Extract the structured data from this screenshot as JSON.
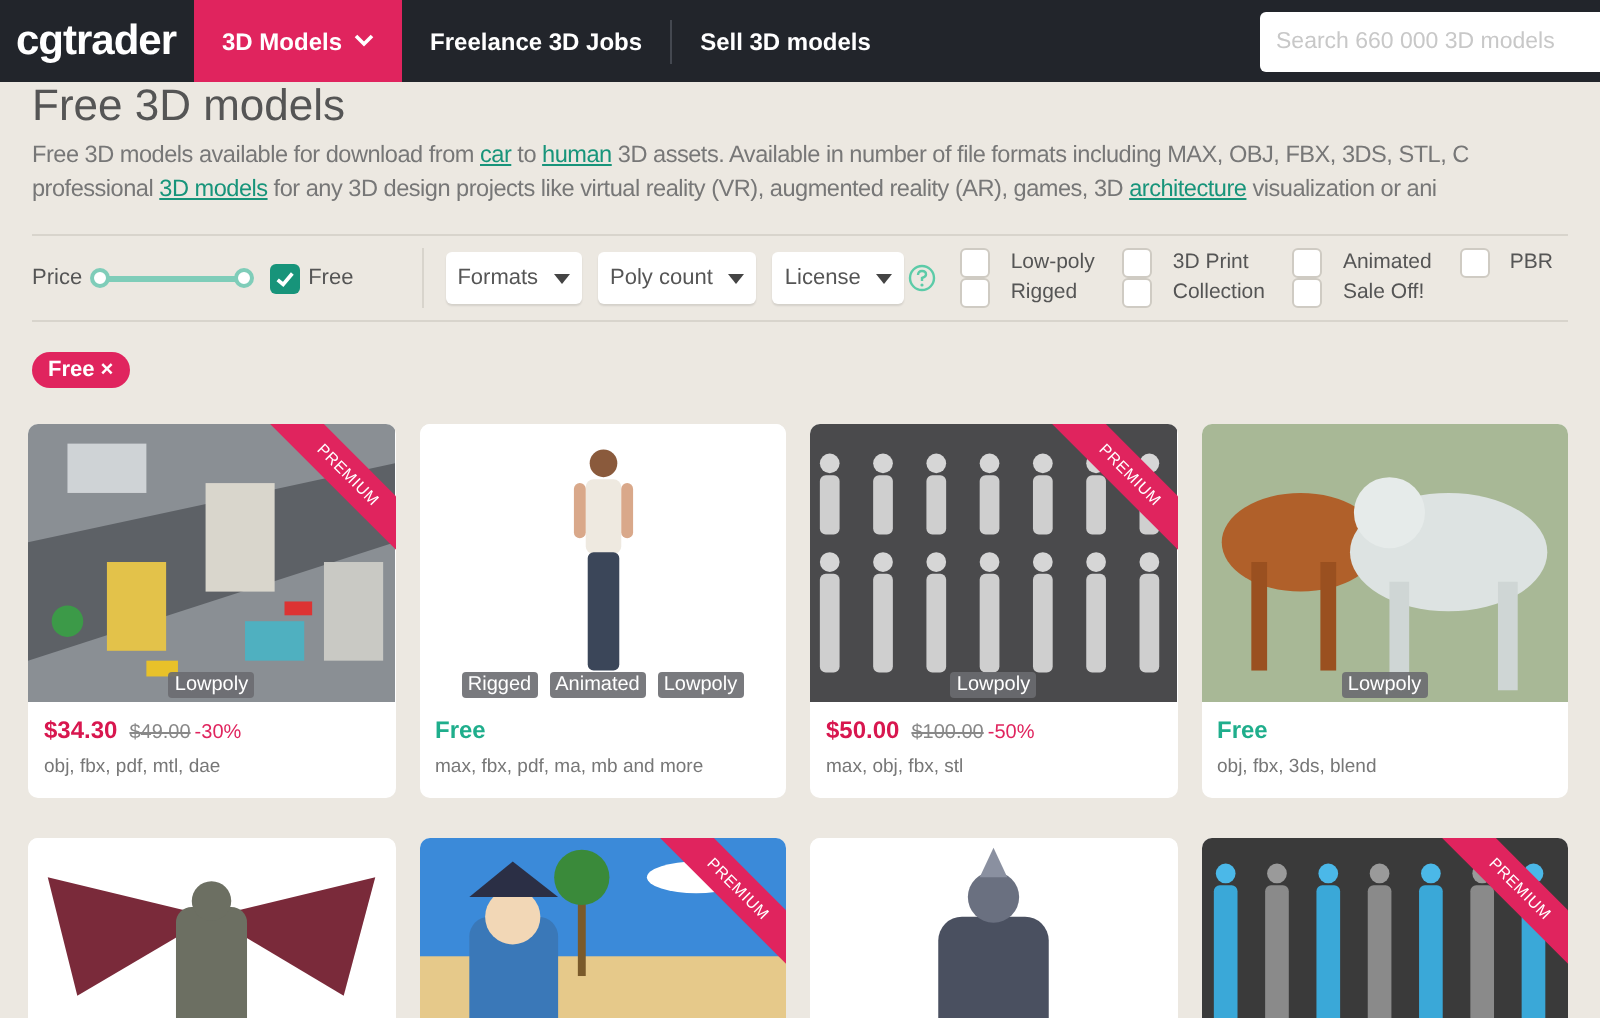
{
  "header": {
    "logo": "cgtrader",
    "nav": [
      {
        "label": "3D Models",
        "selected": true,
        "dropdown": true
      },
      {
        "label": "Freelance 3D Jobs",
        "selected": false,
        "dropdown": false
      },
      {
        "label": "Sell 3D models",
        "selected": false,
        "dropdown": false
      }
    ],
    "search": {
      "placeholder": "Search 660 000 3D models"
    }
  },
  "title": "Free 3D models",
  "description": [
    [
      {
        "kind": "text",
        "text": "Free 3D models available for download from "
      },
      {
        "kind": "link",
        "text": "car"
      },
      {
        "kind": "text",
        "text": " to "
      },
      {
        "kind": "link",
        "text": "human"
      },
      {
        "kind": "text",
        "text": " 3D assets. Available in number of file formats including MAX, OBJ, FBX, 3DS, STL, C"
      }
    ],
    [
      {
        "kind": "text",
        "text": "professional "
      },
      {
        "kind": "link",
        "text": "3D models"
      },
      {
        "kind": "text",
        "text": " for any 3D design projects like virtual reality (VR), augmented reality (AR), games, 3D "
      },
      {
        "kind": "link",
        "text": "architecture"
      },
      {
        "kind": "text",
        "text": " visualization or ani"
      }
    ]
  ],
  "filters": {
    "price": {
      "label": "Price",
      "level": 1
    },
    "free": {
      "label": "Free",
      "checked": true
    },
    "dropdowns": [
      "Formats",
      "Poly count",
      "License"
    ],
    "checkboxes": [
      {
        "label": "Low-poly",
        "checked": false
      },
      {
        "label": "Rigged",
        "checked": false
      },
      {
        "label": "3D Print",
        "checked": false
      },
      {
        "label": "Collection",
        "checked": false
      },
      {
        "label": "Animated",
        "checked": false
      },
      {
        "label": "Sale Off!",
        "checked": false
      },
      {
        "label": "PBR",
        "checked": false
      }
    ]
  },
  "active_filters": [
    {
      "label": "Free",
      "remove": "×"
    }
  ],
  "cards": [
    {
      "kind": "picture",
      "premium": "PREMIUM",
      "tags": [
        "Lowpoly"
      ],
      "price": "$34.30",
      "free": false,
      "old_price": "$49.00",
      "discount": "-30%",
      "formats": "obj, fbx, pdf, mtl, dae"
    },
    {
      "kind": "picture",
      "tags": [
        "Rigged",
        "Animated",
        "Lowpoly"
      ],
      "price": "Free",
      "free": true,
      "formats": "max, fbx, pdf, ma, mb and more"
    },
    {
      "kind": "picture",
      "premium": "PREMIUM",
      "tags": [
        "Lowpoly"
      ],
      "price": "$50.00",
      "free": false,
      "old_price": "$100.00",
      "discount": "-50%",
      "formats": "max, obj, fbx, stl"
    },
    {
      "kind": "picture",
      "tags": [
        "Lowpoly"
      ],
      "price": "Free",
      "free": true,
      "formats": "obj, fbx, 3ds, blend"
    },
    {
      "kind": "picture"
    },
    {
      "kind": "picture",
      "premium": "PREMIUM"
    },
    {
      "kind": "picture"
    },
    {
      "kind": "picture",
      "premium": "PREMIUM"
    }
  ]
}
